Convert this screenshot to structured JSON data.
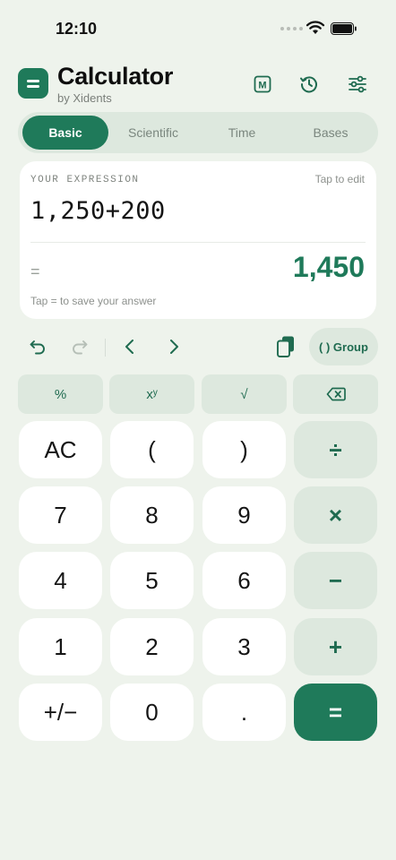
{
  "status": {
    "time": "12:10"
  },
  "header": {
    "title": "Calculator",
    "subtitle": "by Xidents",
    "memory_label": "M"
  },
  "tabs": [
    {
      "label": "Basic",
      "active": true
    },
    {
      "label": "Scientific",
      "active": false
    },
    {
      "label": "Time",
      "active": false
    },
    {
      "label": "Bases",
      "active": false
    }
  ],
  "expression": {
    "label": "YOUR EXPRESSION",
    "tap_to_edit": "Tap to edit",
    "value": "1,250+200",
    "equals_sign": "=",
    "result": "1,450",
    "hint": "Tap = to save your answer"
  },
  "toolbar": {
    "group_label": "( ) Group"
  },
  "function_keys": [
    "%",
    "xʸ",
    "√"
  ],
  "keypad": {
    "row1": [
      "AC",
      "(",
      ")",
      "÷"
    ],
    "row2": [
      "7",
      "8",
      "9",
      "×"
    ],
    "row3": [
      "4",
      "5",
      "6",
      "−"
    ],
    "row4": [
      "1",
      "2",
      "3",
      "+"
    ],
    "row5": [
      "+/−",
      "0",
      ".",
      "="
    ]
  },
  "colors": {
    "accent": "#1f7a5a",
    "soft": "#dde8de",
    "background": "#eef3ec"
  },
  "icons": [
    "wifi-icon",
    "battery-icon",
    "memory-icon",
    "history-icon",
    "settings-sliders-icon",
    "undo-icon",
    "redo-icon",
    "cursor-left-icon",
    "cursor-right-icon",
    "copy-icon",
    "backspace-icon"
  ]
}
